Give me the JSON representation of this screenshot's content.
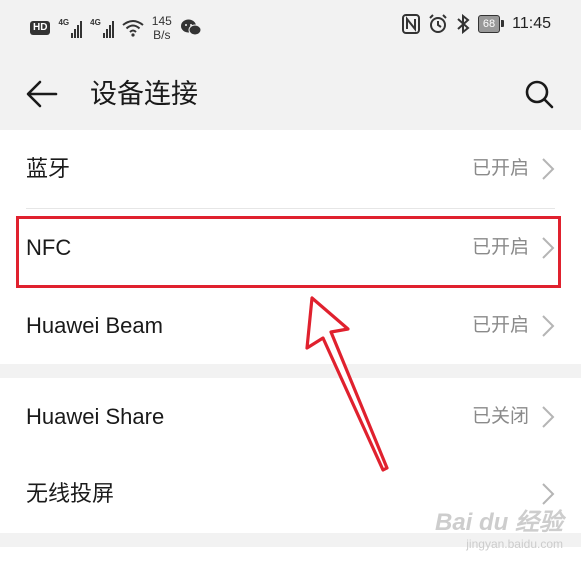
{
  "status_bar": {
    "left": {
      "hd": "HD",
      "signal1": "4G",
      "signal2": "4G",
      "net_speed_value": "145",
      "net_speed_unit": "B/s",
      "icons": [
        "hd-icon",
        "signal-4g-icon",
        "signal-4g-icon",
        "wifi-icon",
        "wechat-icon"
      ]
    },
    "right": {
      "battery": "68",
      "time": "11:45",
      "icons": [
        "nfc-icon",
        "alarm-icon",
        "bluetooth-icon",
        "battery-icon"
      ]
    }
  },
  "header": {
    "title": "设备连接",
    "back_icon": "arrow-left-icon",
    "search_icon": "search-icon"
  },
  "sections": [
    {
      "items": [
        {
          "label": "蓝牙",
          "status": "已开启"
        },
        {
          "label": "NFC",
          "status": "已开启"
        },
        {
          "label": "Huawei Beam",
          "status": "已开启"
        }
      ]
    },
    {
      "items": [
        {
          "label": "Huawei Share",
          "status": "已关闭"
        },
        {
          "label": "无线投屏",
          "status": ""
        }
      ]
    }
  ],
  "annotation": {
    "highlight_color": "#e0212e"
  },
  "watermark": {
    "brand": "Bai du 经验",
    "url": "jingyan.baidu.com"
  },
  "colors": {
    "background": "#f2f2f2",
    "card": "#ffffff",
    "text_primary": "#1a1a1a",
    "text_secondary": "#8a8a8a",
    "annotation_red": "#e0212e"
  }
}
